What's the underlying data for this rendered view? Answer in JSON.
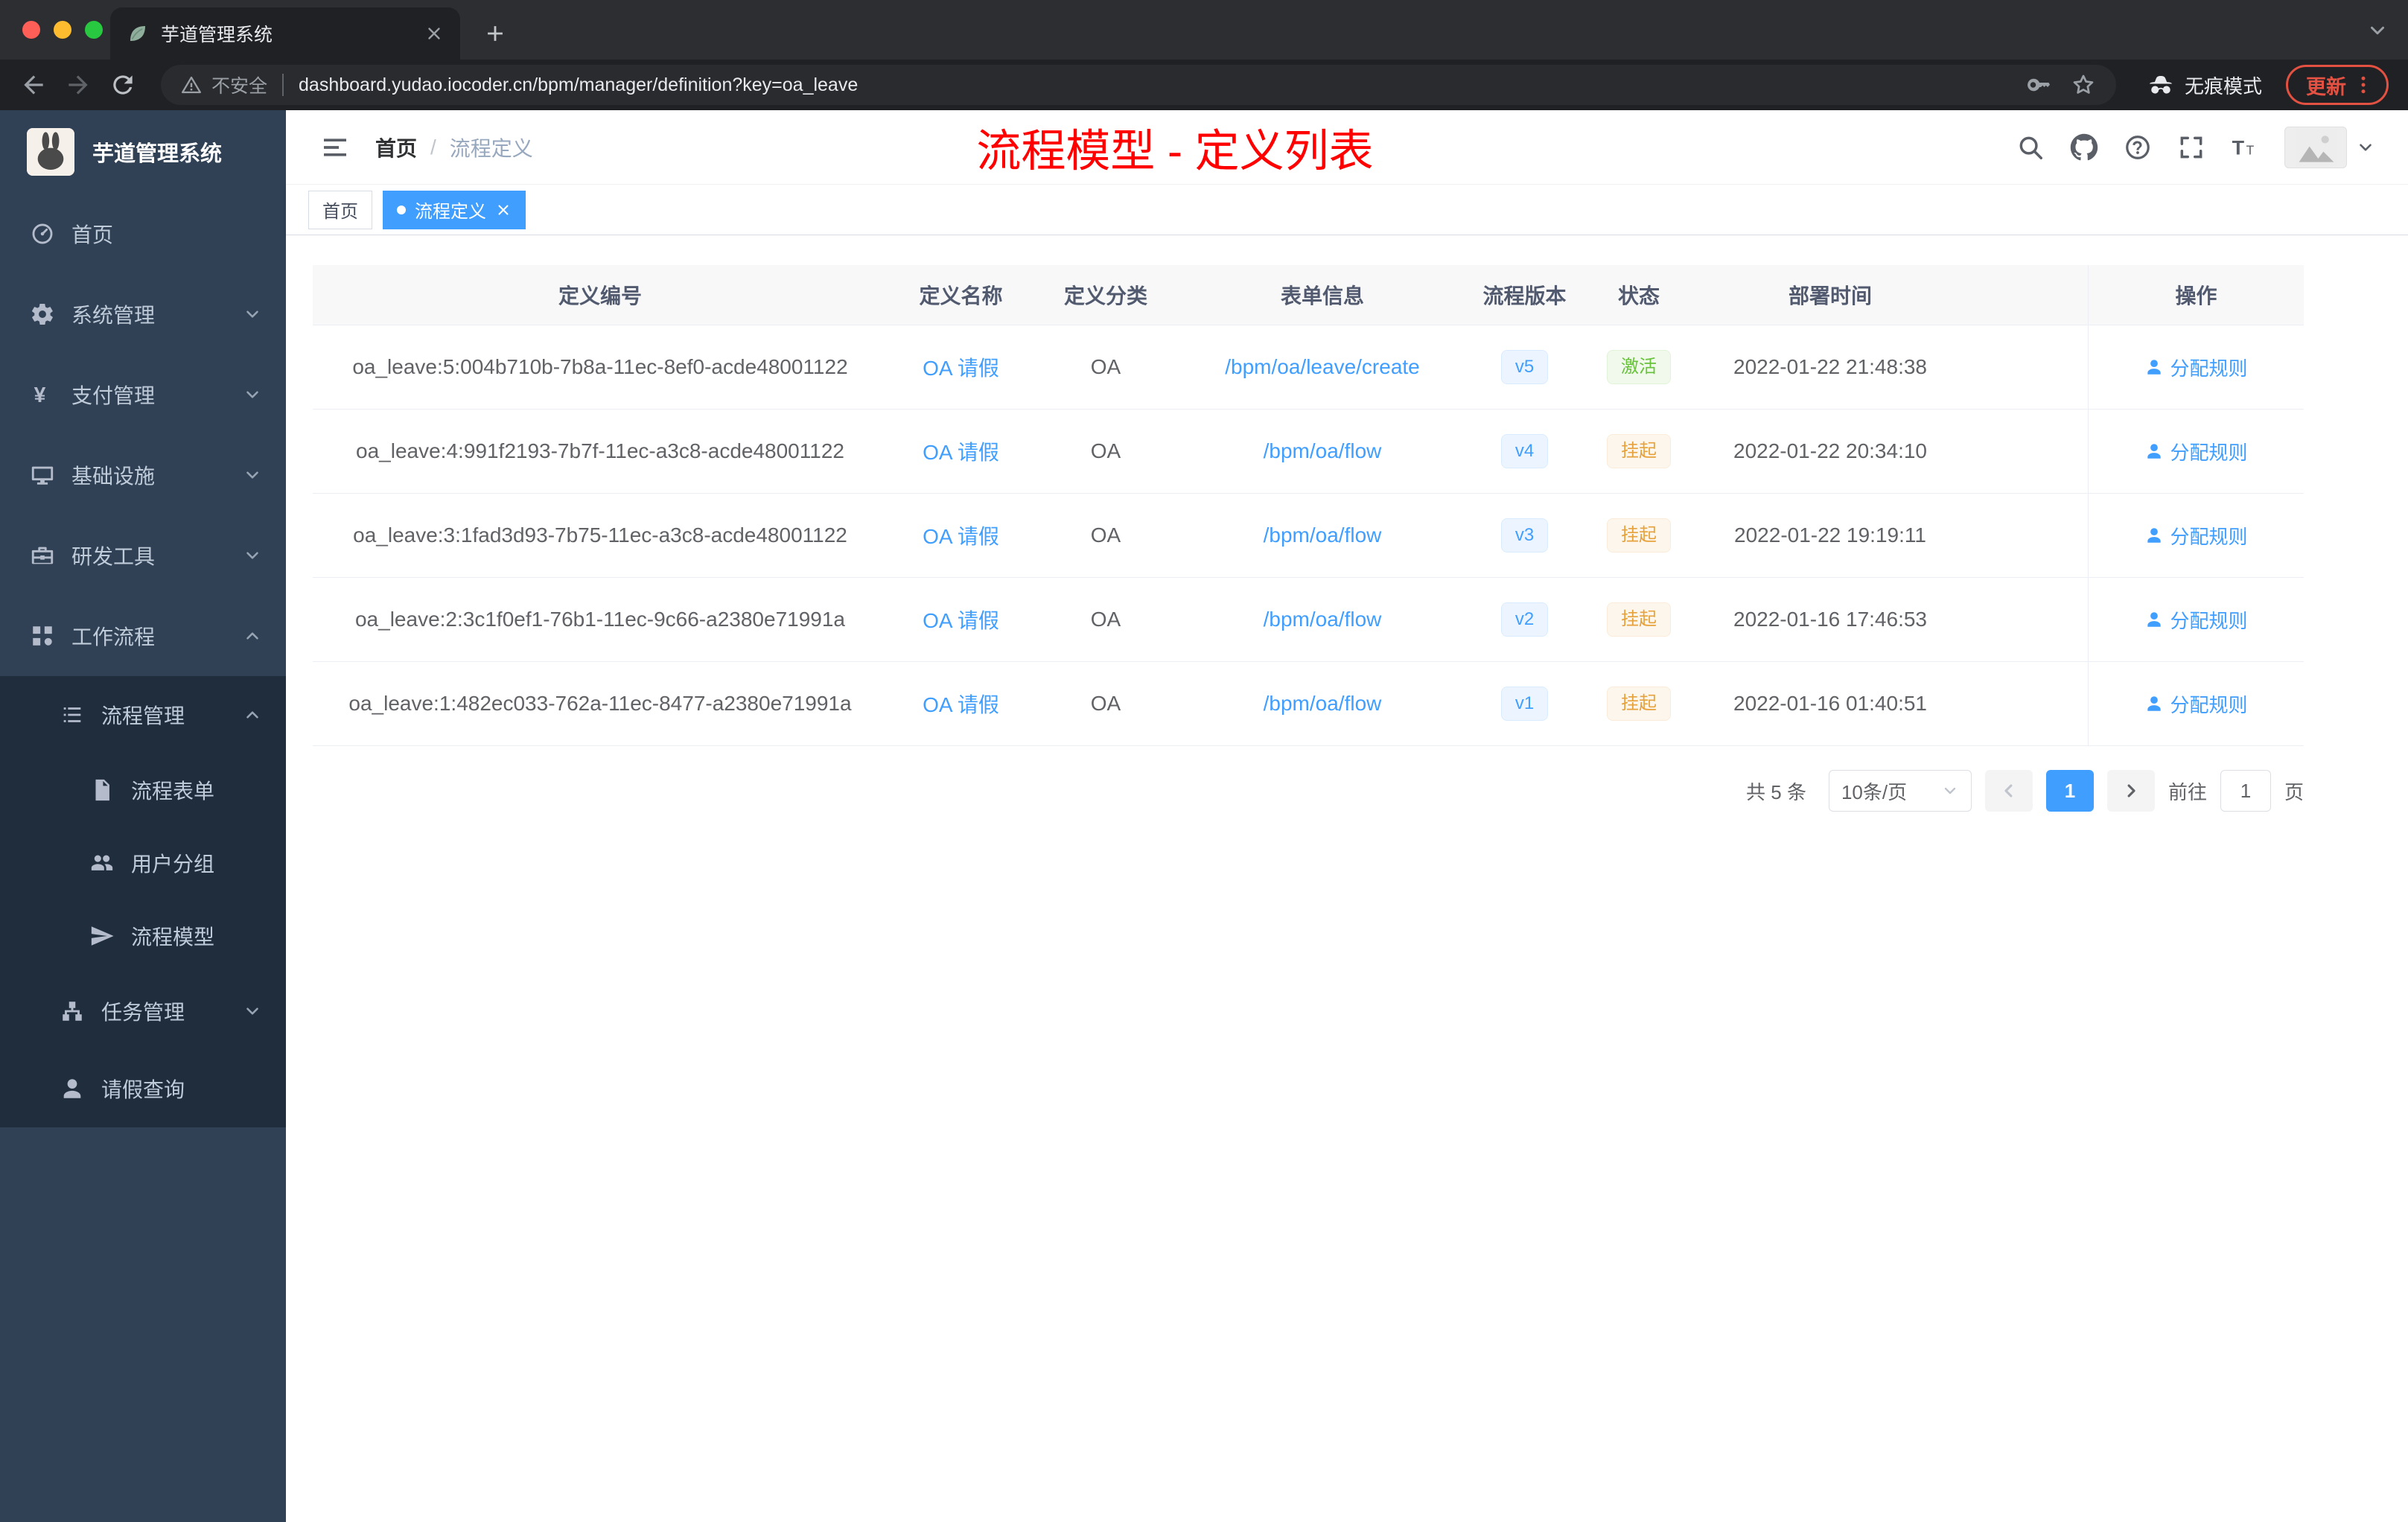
{
  "colors": {
    "accent_blue": "#409eff",
    "success_green": "#67c23a",
    "warning_orange": "#e6a23c",
    "annotation_red": "#ff0000",
    "update_red": "#e25142",
    "sidebar_bg": "#304156",
    "submenu_bg": "#1f2d3d"
  },
  "browser": {
    "tab": {
      "title": "芋道管理系统"
    },
    "address": {
      "security_label": "不安全",
      "url": "dashboard.yudao.iocoder.cn/bpm/manager/definition?key=oa_leave"
    },
    "incognito_label": "无痕模式",
    "update_label": "更新"
  },
  "sidebar": {
    "app_title": "芋道管理系统",
    "menu": [
      {
        "label": "首页",
        "icon": "dashboard-icon"
      },
      {
        "label": "系统管理",
        "icon": "gear-icon",
        "chevron": "down"
      },
      {
        "label": "支付管理",
        "icon": "yen-icon",
        "chevron": "down"
      },
      {
        "label": "基础设施",
        "icon": "monitor-icon",
        "chevron": "down"
      },
      {
        "label": "研发工具",
        "icon": "briefcase-icon",
        "chevron": "down"
      },
      {
        "label": "工作流程",
        "icon": "workflow-icon",
        "chevron": "up"
      },
      {
        "label": "流程管理",
        "icon": "list-icon",
        "chevron": "up"
      },
      {
        "label": "流程表单",
        "icon": "document-icon"
      },
      {
        "label": "用户分组",
        "icon": "people-icon"
      },
      {
        "label": "流程模型",
        "icon": "send-icon"
      },
      {
        "label": "任务管理",
        "icon": "tree-icon",
        "chevron": "down"
      },
      {
        "label": "请假查询",
        "icon": "user-icon"
      }
    ]
  },
  "header": {
    "breadcrumb": {
      "home": "首页",
      "separator": "/",
      "current": "流程定义"
    },
    "annotation": "流程模型 - 定义列表"
  },
  "tags": {
    "items": [
      {
        "label": "首页",
        "active": false
      },
      {
        "label": "流程定义",
        "active": true
      }
    ]
  },
  "table": {
    "columns": {
      "id": "定义编号",
      "name": "定义名称",
      "category": "定义分类",
      "form": "表单信息",
      "version": "流程版本",
      "status": "状态",
      "deploy_time": "部署时间",
      "action": "操作"
    },
    "rows": [
      {
        "id": "oa_leave:5:004b710b-7b8a-11ec-8ef0-acde48001122",
        "name": "OA 请假",
        "category": "OA",
        "form": "/bpm/oa/leave/create",
        "version": "v5",
        "status": "激活",
        "status_type": "success",
        "deploy_time": "2022-01-22 21:48:38",
        "action": "分配规则"
      },
      {
        "id": "oa_leave:4:991f2193-7b7f-11ec-a3c8-acde48001122",
        "name": "OA 请假",
        "category": "OA",
        "form": "/bpm/oa/flow",
        "version": "v4",
        "status": "挂起",
        "status_type": "warning",
        "deploy_time": "2022-01-22 20:34:10",
        "action": "分配规则"
      },
      {
        "id": "oa_leave:3:1fad3d93-7b75-11ec-a3c8-acde48001122",
        "name": "OA 请假",
        "category": "OA",
        "form": "/bpm/oa/flow",
        "version": "v3",
        "status": "挂起",
        "status_type": "warning",
        "deploy_time": "2022-01-22 19:19:11",
        "action": "分配规则"
      },
      {
        "id": "oa_leave:2:3c1f0ef1-76b1-11ec-9c66-a2380e71991a",
        "name": "OA 请假",
        "category": "OA",
        "form": "/bpm/oa/flow",
        "version": "v2",
        "status": "挂起",
        "status_type": "warning",
        "deploy_time": "2022-01-16 17:46:53",
        "action": "分配规则"
      },
      {
        "id": "oa_leave:1:482ec033-762a-11ec-8477-a2380e71991a",
        "name": "OA 请假",
        "category": "OA",
        "form": "/bpm/oa/flow",
        "version": "v1",
        "status": "挂起",
        "status_type": "warning",
        "deploy_time": "2022-01-16 01:40:51",
        "action": "分配规则"
      }
    ]
  },
  "pagination": {
    "total": "共 5 条",
    "page_size": "10条/页",
    "current_page": "1",
    "goto_label": "前往",
    "goto_value": "1",
    "page_unit": "页"
  }
}
